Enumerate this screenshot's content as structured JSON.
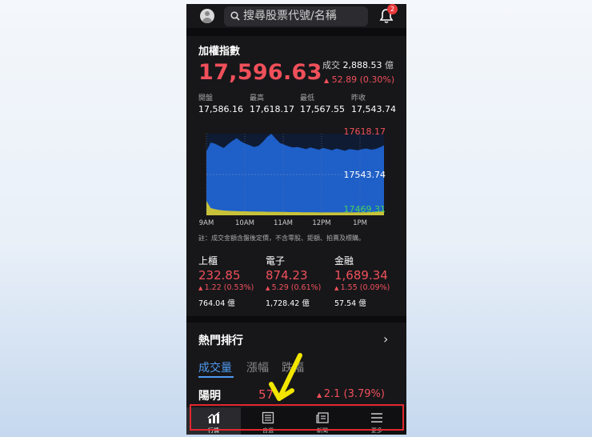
{
  "search": {
    "placeholder": "搜尋股票代號/名稱"
  },
  "notifications": {
    "count": "2"
  },
  "index": {
    "title": "加權指數",
    "value": "17,596.63",
    "volume_label": "成交",
    "volume": "2,888.53",
    "volume_unit": "億",
    "change": "52.89 (0.30%)",
    "stats": [
      {
        "label": "開盤",
        "value": "17,586.16"
      },
      {
        "label": "最高",
        "value": "17,618.17"
      },
      {
        "label": "最低",
        "value": "17,567.55"
      },
      {
        "label": "昨收",
        "value": "17,543.74"
      }
    ]
  },
  "chart_data": {
    "type": "area",
    "x_ticks": [
      "9AM",
      "10AM",
      "11AM",
      "12PM",
      "1PM"
    ],
    "y_labels": [
      "17618.17",
      "17543.74",
      "17469.31"
    ],
    "ylim": [
      17469.31,
      17618.17
    ],
    "reference": 17543.74,
    "colors": {
      "price": "#1e5fc8",
      "volume": "#c8c23a",
      "high": "#f0505a",
      "ref": "#ffffff",
      "low": "#46d35a"
    },
    "price_series": [
      17586,
      17602,
      17600,
      17596,
      17592,
      17599,
      17605,
      17610,
      17604,
      17600,
      17597,
      17594,
      17596,
      17603,
      17612,
      17618,
      17609,
      17601,
      17598,
      17595,
      17593,
      17594,
      17592,
      17590,
      17593,
      17591,
      17589,
      17592,
      17590,
      17588,
      17591,
      17589,
      17587,
      17590,
      17589,
      17588,
      17590,
      17591,
      17589,
      17590,
      17593,
      17597
    ],
    "volume_series": [
      0.9,
      0.45,
      0.38,
      0.33,
      0.3,
      0.28,
      0.27,
      0.26,
      0.25,
      0.25,
      0.24,
      0.24,
      0.23,
      0.23,
      0.22,
      0.22,
      0.22,
      0.21,
      0.21,
      0.2,
      0.2,
      0.2,
      0.19,
      0.19,
      0.19,
      0.19,
      0.18,
      0.18,
      0.18,
      0.18,
      0.18,
      0.18,
      0.18,
      0.18,
      0.18,
      0.19,
      0.19,
      0.19,
      0.2,
      0.21,
      0.23,
      0.3
    ]
  },
  "note": "註：成交金額含盤後定價，不含零股、鉅額、拍賣及標購。",
  "sectors": [
    {
      "name": "上櫃",
      "value": "232.85",
      "change": "1.22 (0.53%)",
      "volume": "764.04 億"
    },
    {
      "name": "電子",
      "value": "874.23",
      "change": "5.29 (0.61%)",
      "volume": "1,728.42 億"
    },
    {
      "name": "金融",
      "value": "1,689.34",
      "change": "1.55 (0.09%)",
      "volume": "57.54 億"
    }
  ],
  "hot": {
    "title": "熱門排行",
    "tabs": [
      "成交量",
      "漲幅",
      "跌幅"
    ],
    "top_stock": {
      "name": "陽明",
      "price": "57",
      "change": "2.1 (3.79%)"
    }
  },
  "nav": [
    {
      "label": "行情",
      "icon": "chart-icon"
    },
    {
      "label": "自選",
      "icon": "list-icon"
    },
    {
      "label": "新聞",
      "icon": "news-icon"
    },
    {
      "label": "更多",
      "icon": "menu-icon"
    }
  ]
}
